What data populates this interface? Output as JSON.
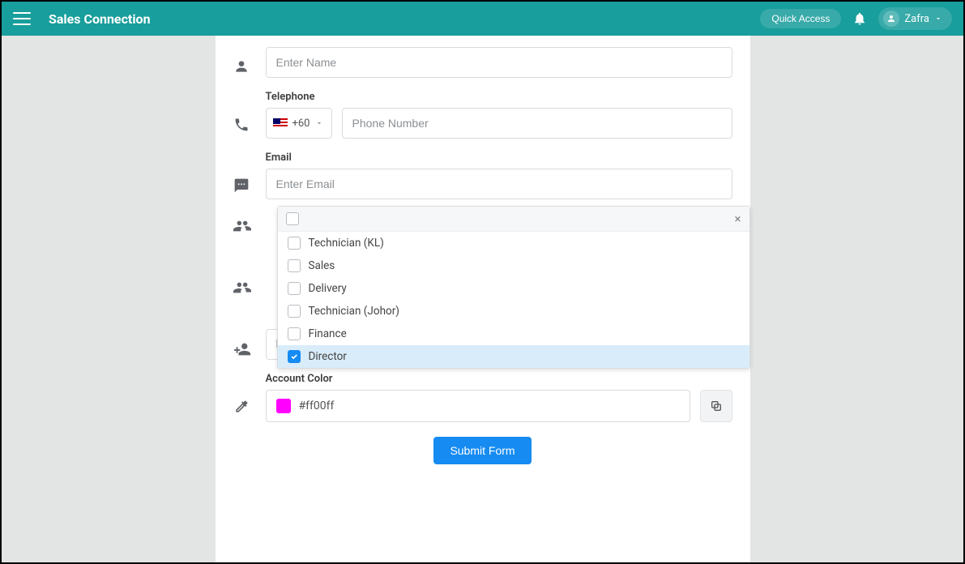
{
  "topbar": {
    "brand": "Sales Connection",
    "quick_access": "Quick Access",
    "username": "Zafra"
  },
  "form": {
    "name_placeholder": "Enter Name",
    "telephone_label": "Telephone",
    "country_code": "+60",
    "phone_placeholder": "Phone Number",
    "email_label": "Email",
    "email_placeholder": "Enter Email",
    "dropdown_options": [
      {
        "label": "Technician (KL)",
        "checked": false
      },
      {
        "label": "Sales",
        "checked": false
      },
      {
        "label": "Delivery",
        "checked": false
      },
      {
        "label": "Technician (Johor)",
        "checked": false
      },
      {
        "label": "Finance",
        "checked": false
      },
      {
        "label": "Director",
        "checked": true
      }
    ],
    "selected_value": "Director",
    "account_color_label": "Account Color",
    "color_value": "#ff00ff",
    "submit_label": "Submit Form"
  }
}
